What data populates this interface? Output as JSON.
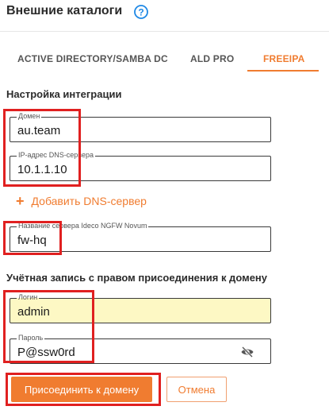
{
  "header": {
    "title": "Внешние каталоги",
    "help_icon": "help-circle-icon"
  },
  "tabs": [
    {
      "label": "ACTIVE DIRECTORY/SAMBA DC",
      "active": false
    },
    {
      "label": "ALD PRO",
      "active": false
    },
    {
      "label": "FREEIPA",
      "active": true
    }
  ],
  "integration": {
    "title": "Настройка интеграции",
    "domain": {
      "label": "Домен",
      "value": "au.team"
    },
    "dns": {
      "label": "IP-адрес DNS-сервера",
      "value": "10.1.1.10"
    },
    "add_dns_label": "Добавить DNS-сервер",
    "server_name": {
      "label": "Название сервера Ideco NGFW Novum",
      "value": "fw-hq"
    }
  },
  "account": {
    "title": "Учётная запись с правом присоединения к домену",
    "login": {
      "label": "Логин",
      "value": "admin"
    },
    "password": {
      "label": "Пароль",
      "value": "P@ssw0rd"
    },
    "visibility_icon": "eye-off-icon"
  },
  "actions": {
    "join_label": "Присоединить к домену",
    "cancel_label": "Отмена"
  },
  "colors": {
    "accent": "#f07c30",
    "highlight": "#e02020",
    "autofill": "#fdf8c4",
    "help": "#1e88e5"
  }
}
